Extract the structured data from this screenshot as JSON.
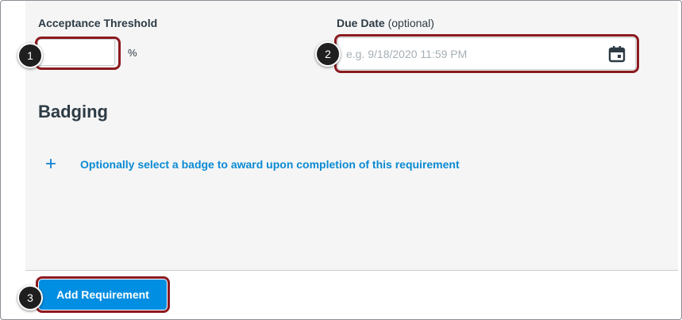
{
  "form": {
    "threshold_label": "Acceptance Threshold",
    "threshold_value": "",
    "percent_symbol": "%",
    "due_label": "Due Date",
    "due_optional": "(optional)",
    "due_placeholder": "e.g. 9/18/2020 11:59 PM"
  },
  "badging": {
    "title": "Badging",
    "select_link": "Optionally select a badge to award upon completion of this requirement"
  },
  "footer": {
    "add_button": "Add Requirement"
  },
  "steps": [
    "1",
    "2",
    "3"
  ],
  "icons": {
    "calendar": "calendar-icon",
    "plus": "plus-icon"
  },
  "colors": {
    "accent": "#008ee2",
    "link": "#0a8ad3",
    "highlight": "#8b1a1f",
    "text": "#2d3b45",
    "panel": "#f5f5f5"
  }
}
